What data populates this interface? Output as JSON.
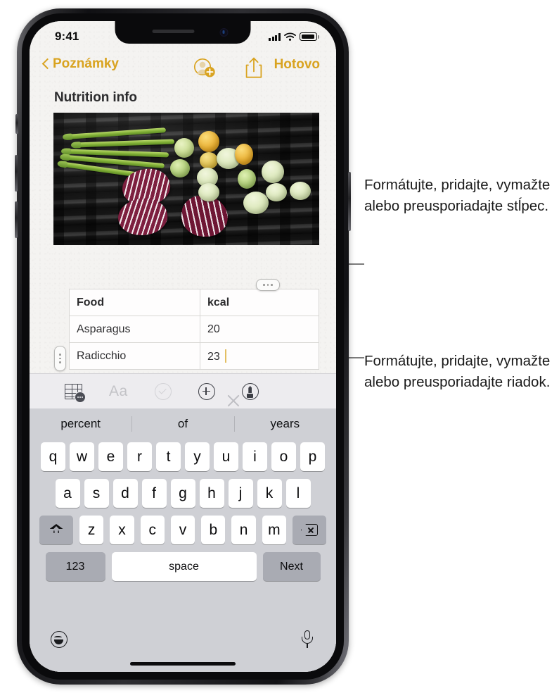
{
  "device": {
    "status_bar": {
      "time": "9:41",
      "cellular_icon": "cellular-bars-icon",
      "wifi_icon": "wifi-icon",
      "battery_icon": "battery-icon"
    }
  },
  "app": {
    "nav": {
      "back_label": "Poznámky",
      "back_icon": "chevron-left-icon",
      "add_person_icon": "add-person-icon",
      "share_icon": "share-icon",
      "done_label": "Hotovo"
    },
    "note": {
      "title": "Nutrition info",
      "photo_alt": "grilled-vegetables-photo"
    },
    "table": {
      "column_handle_icon": "column-handle-dots-icon",
      "row_handle_icon": "row-handle-dots-icon",
      "headers": [
        "Food",
        "kcal"
      ],
      "rows": [
        [
          "Asparagus",
          "20"
        ],
        [
          "Radicchio",
          "23"
        ]
      ],
      "caret_color": "#e3bf63",
      "editing_cell": "23"
    }
  },
  "format_toolbar": {
    "items": [
      {
        "name": "table-options-icon",
        "label": ""
      },
      {
        "name": "text-format-icon",
        "label": "Aa"
      },
      {
        "name": "checklist-icon",
        "label": ""
      },
      {
        "name": "add-attachment-icon",
        "label": ""
      },
      {
        "name": "markup-pen-icon",
        "label": ""
      }
    ],
    "close_icon": "close-icon"
  },
  "keyboard": {
    "suggestions": [
      "percent",
      "of",
      "years"
    ],
    "rows": [
      [
        "q",
        "w",
        "e",
        "r",
        "t",
        "y",
        "u",
        "i",
        "o",
        "p"
      ],
      [
        "a",
        "s",
        "d",
        "f",
        "g",
        "h",
        "j",
        "k",
        "l"
      ],
      [
        "z",
        "x",
        "c",
        "v",
        "b",
        "n",
        "m"
      ]
    ],
    "shift_icon": "shift-icon",
    "delete_icon": "delete-backward-icon",
    "numbers_label": "123",
    "space_label": "space",
    "next_label": "Next",
    "emoji_icon": "emoji-icon",
    "dictation_icon": "microphone-icon"
  },
  "callouts": [
    {
      "id": "column-callout",
      "text": "Formátujte, pridajte, vymažte alebo preusporiadajte stĺpec."
    },
    {
      "id": "row-callout",
      "text": "Formátujte, pridajte, vymažte alebo preusporiadajte riadok."
    }
  ],
  "colors": {
    "accent": "#d9a320",
    "keyboard_bg": "#cfd0d5",
    "toolbar_bg": "#edecef",
    "paper": "#f4f3f1"
  }
}
